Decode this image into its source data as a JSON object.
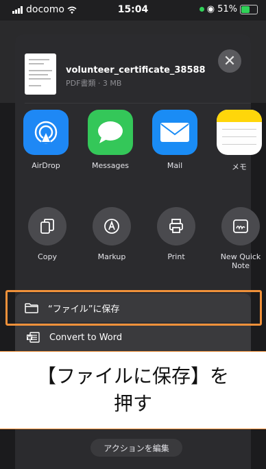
{
  "status_bar": {
    "carrier": "docomo",
    "time": "15:04",
    "battery": "51%"
  },
  "document": {
    "title": "volunteer_certificate_38588",
    "subtitle": "PDF書類 · 3 MB"
  },
  "apps": [
    {
      "label": "AirDrop",
      "icon": "airdrop-icon",
      "color": "#1e88f5"
    },
    {
      "label": "Messages",
      "icon": "messages-icon",
      "color": "#34c759"
    },
    {
      "label": "Mail",
      "icon": "mail-icon",
      "color": "#1a8cf5"
    },
    {
      "label": "メモ",
      "icon": "notes-icon",
      "color": "#ffd60a"
    }
  ],
  "actions": [
    {
      "label": "Copy",
      "icon": "copy-icon"
    },
    {
      "label": "Markup",
      "icon": "markup-icon"
    },
    {
      "label": "Print",
      "icon": "print-icon"
    },
    {
      "label": "New Quick Note",
      "icon": "quick-note-icon"
    }
  ],
  "menu": [
    {
      "label": "“ファイル”に保存",
      "icon": "folder-icon"
    },
    {
      "label": "Convert to Word",
      "icon": "word-icon"
    }
  ],
  "callout": {
    "line1": "【ファイルに保存】を",
    "line2": "押す"
  },
  "edit_actions_label": "アクションを編集"
}
